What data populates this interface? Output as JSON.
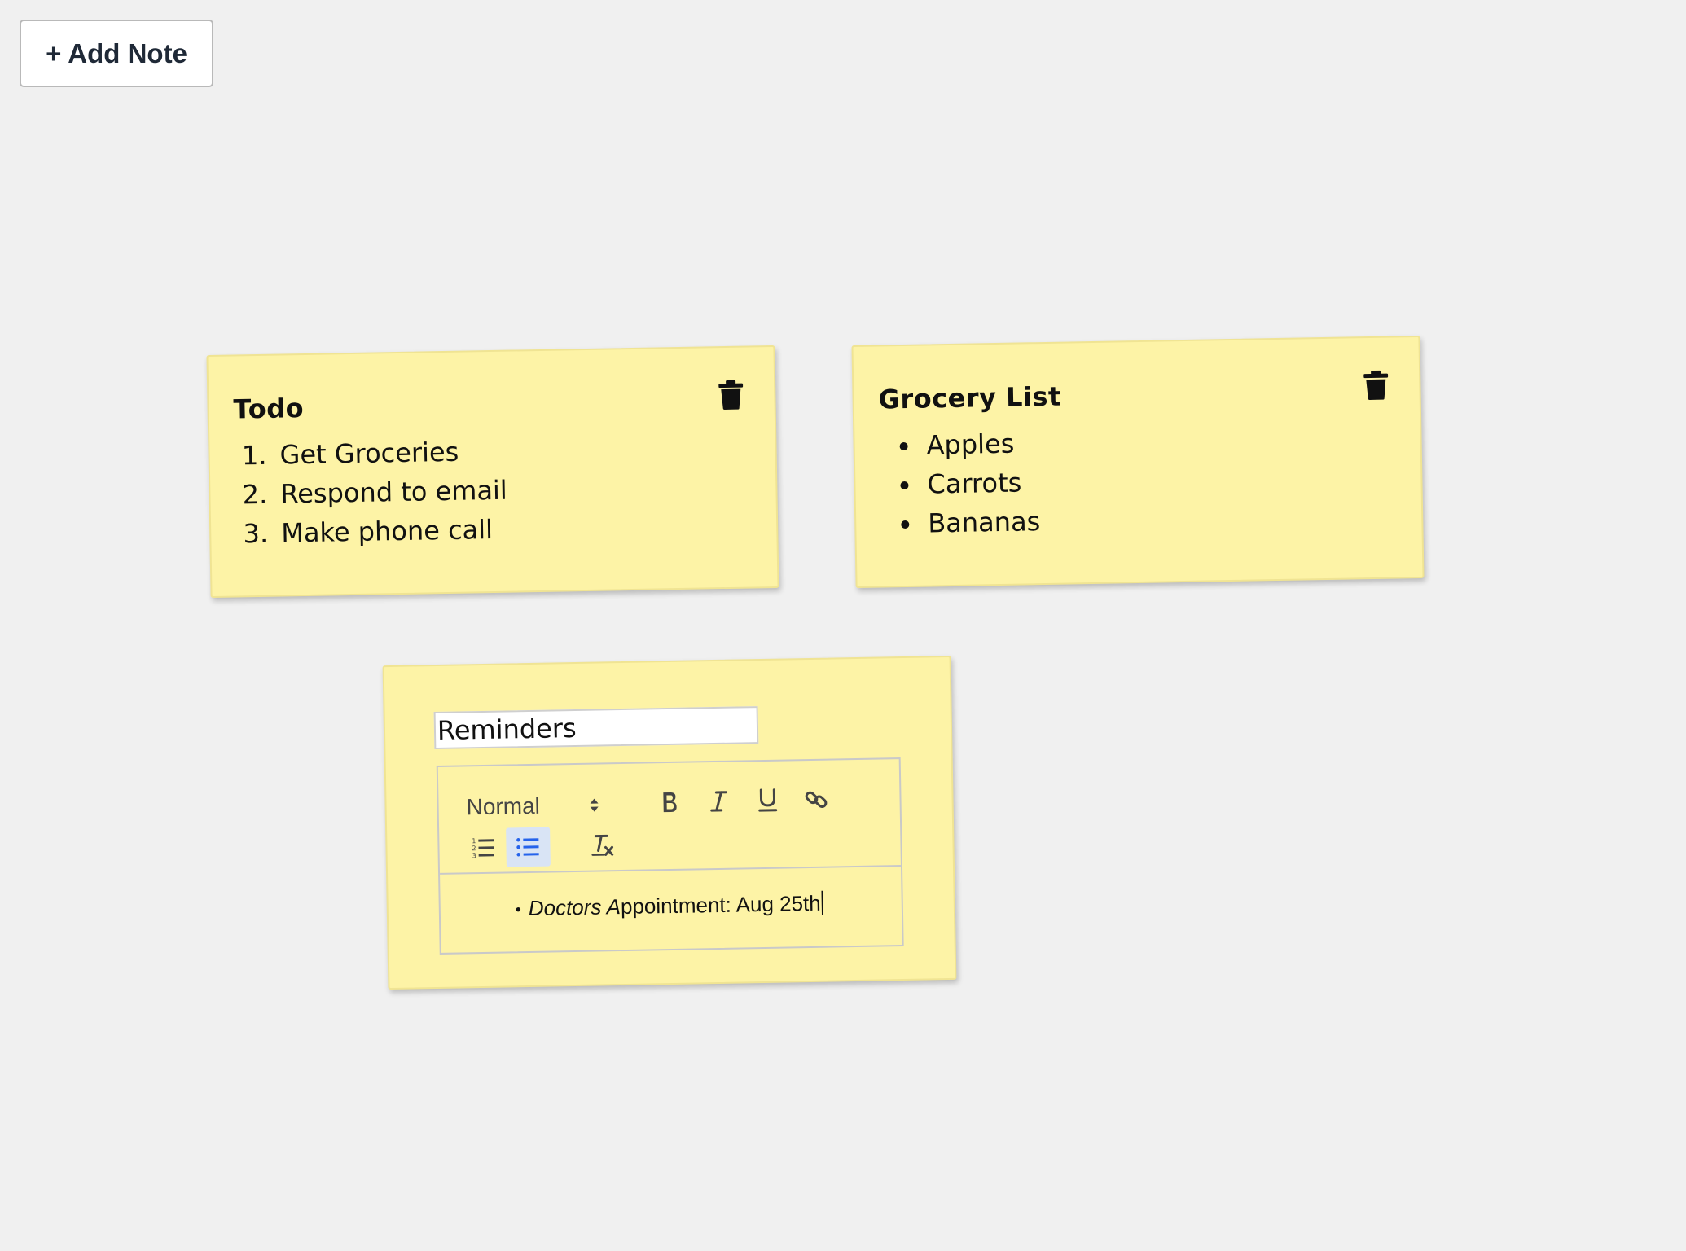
{
  "toolbar": {
    "add_note_label": "+ Add Note"
  },
  "notes": [
    {
      "title": "Todo",
      "list_type": "ordered",
      "items": [
        "Get Groceries",
        "Respond to email",
        "Make phone call"
      ]
    },
    {
      "title": "Grocery List",
      "list_type": "bullet",
      "items": [
        "Apples",
        "Carrots",
        "Bananas"
      ]
    }
  ],
  "editing_note": {
    "title_value": "Reminders",
    "format_select": "Normal",
    "active_button": "bullet-list",
    "content": {
      "italic_part": "Doctors A",
      "rest": "ppointment: Aug 25th"
    }
  },
  "colors": {
    "background": "#f0f0f0",
    "note": "#fdf3a6",
    "active_button": "#d9e4f5",
    "accent": "#2563eb"
  },
  "icons": [
    "trash-icon",
    "bold-icon",
    "italic-icon",
    "underline-icon",
    "link-icon",
    "ordered-list-icon",
    "bullet-list-icon",
    "clear-format-icon",
    "select-arrows-icon"
  ]
}
